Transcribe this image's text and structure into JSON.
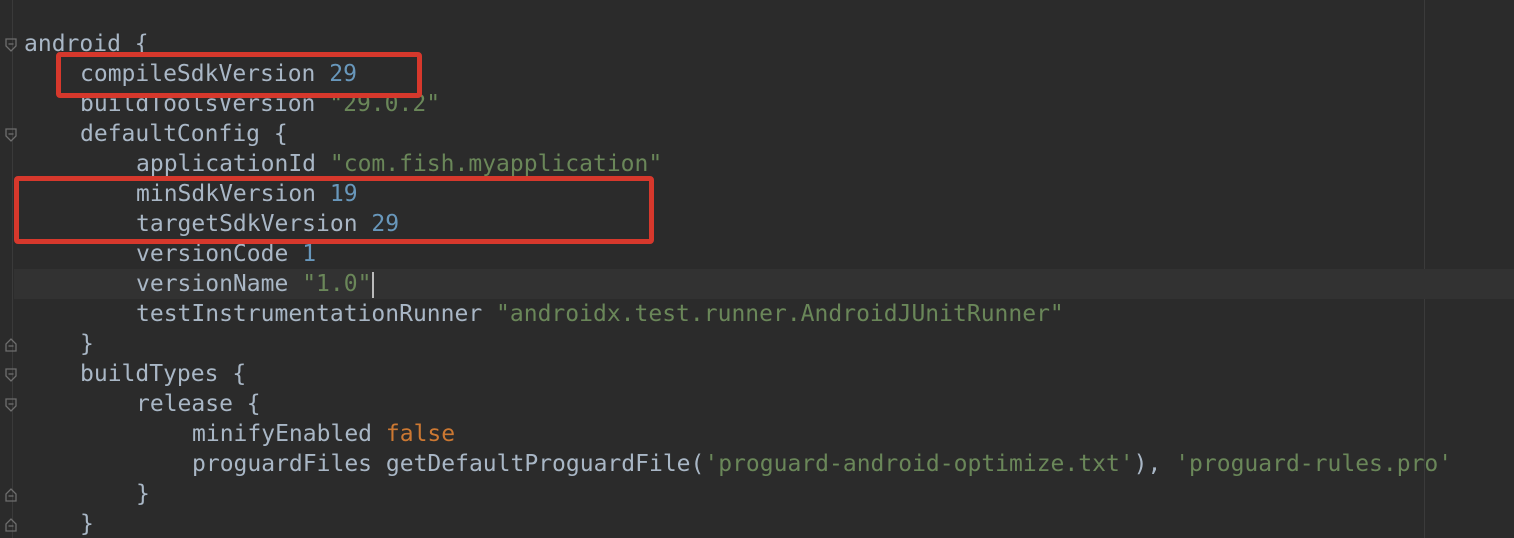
{
  "code": {
    "l1": {
      "kw": "android",
      "brace": " {"
    },
    "l2": {
      "kw": "compileSdkVersion",
      "val": "29"
    },
    "l3": {
      "kw": "buildToolsVersion",
      "val": "\"29.0.2\""
    },
    "l4": {
      "kw": "defaultConfig",
      "brace": " {"
    },
    "l5": {
      "kw": "applicationId",
      "val": "\"com.fish.myapplication\""
    },
    "l6": {
      "kw": "minSdkVersion",
      "val": "19"
    },
    "l7": {
      "kw": "targetSdkVersion",
      "val": "29"
    },
    "l8": {
      "kw": "versionCode",
      "val": "1"
    },
    "l9": {
      "kw": "versionName",
      "val": "\"1.0\""
    },
    "l10": {
      "kw": "testInstrumentationRunner",
      "val": "\"androidx.test.runner.AndroidJUnitRunner\""
    },
    "l11": {
      "brace": "}"
    },
    "l12": {
      "kw": "buildTypes",
      "brace": " {"
    },
    "l13": {
      "kw": "release",
      "brace": " {"
    },
    "l14": {
      "kw": "minifyEnabled",
      "val": "false"
    },
    "l15": {
      "kw": "proguardFiles",
      "fn": "getDefaultProguardFile(",
      "arg1": "'proguard-android-optimize.txt'",
      "sep": "), ",
      "arg2": "'proguard-rules.pro'"
    },
    "l16": {
      "brace": "}"
    },
    "l17": {
      "brace": "}"
    }
  },
  "colors": {
    "background": "#2b2b2b",
    "identifier": "#a9b7c6",
    "number": "#6897bb",
    "string": "#6a8759",
    "keyword": "#cc7832",
    "highlight_box": "#d6382c"
  }
}
